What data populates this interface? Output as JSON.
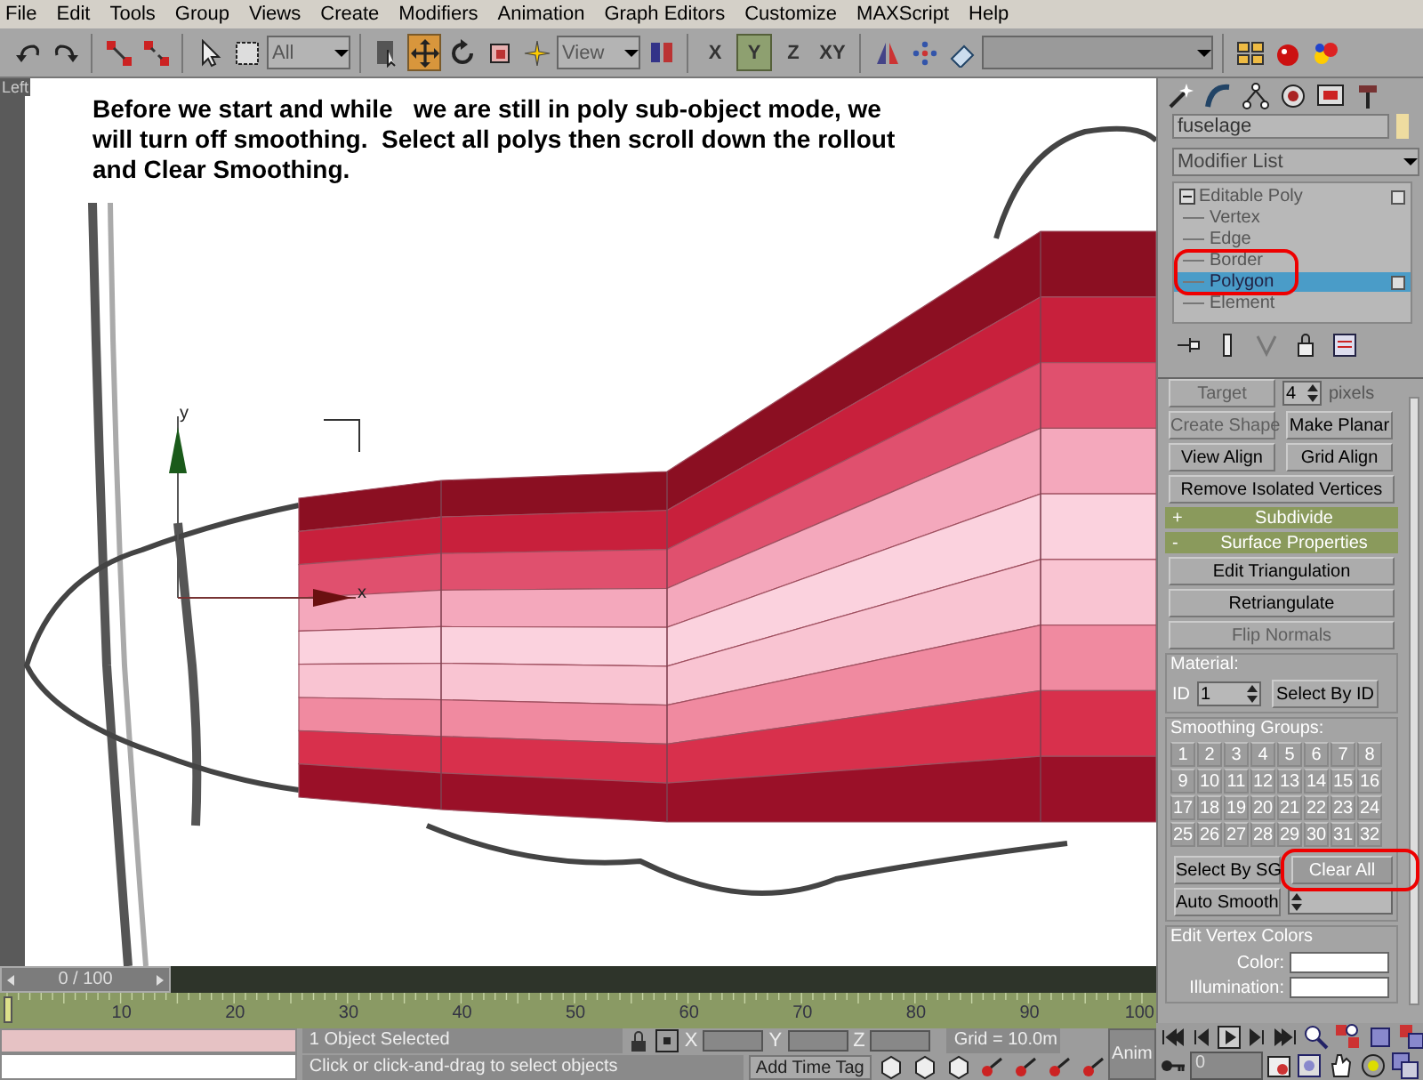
{
  "menu_bar": [
    "File",
    "Edit",
    "Tools",
    "Group",
    "Views",
    "Create",
    "Modifiers",
    "Animation",
    "Graph Editors",
    "Customize",
    "MAXScript",
    "Help"
  ],
  "toolbar": [
    {
      "kind": "tool",
      "selected": false
    },
    {
      "kind": "tool",
      "selected": false
    },
    {
      "kind": "separator"
    },
    {
      "kind": "tool",
      "selected": false
    },
    {
      "kind": "tool",
      "selected": false
    },
    {
      "kind": "separator"
    },
    {
      "kind": "tool",
      "selected": false
    },
    {
      "kind": "tool",
      "selected": false
    },
    {
      "kind": "dropdown",
      "value": "All"
    },
    {
      "kind": "separator"
    },
    {
      "kind": "tool",
      "selected": false
    },
    {
      "kind": "tool",
      "selected": true
    },
    {
      "kind": "tool",
      "selected": false
    },
    {
      "kind": "tool",
      "selected": false
    },
    {
      "kind": "tool",
      "selected": false
    },
    {
      "kind": "dropdown",
      "value": "View"
    },
    {
      "kind": "tool",
      "selected": false
    },
    {
      "kind": "separator"
    },
    {
      "kind": "axis",
      "label": "X",
      "selected": false
    },
    {
      "kind": "axis",
      "label": "Y",
      "selected": true
    },
    {
      "kind": "axis",
      "label": "Z",
      "selected": false
    },
    {
      "kind": "axis",
      "label": "XY",
      "selected": false
    },
    {
      "kind": "separator"
    },
    {
      "kind": "tool",
      "selected": false
    },
    {
      "kind": "tool",
      "selected": false
    },
    {
      "kind": "tool",
      "selected": false
    },
    {
      "kind": "dropdown"
    },
    {
      "kind": "separator"
    },
    {
      "kind": "tool",
      "selected": false
    },
    {
      "kind": "tool",
      "selected": false
    },
    {
      "kind": "tool",
      "selected": false
    }
  ],
  "viewport": {
    "label": "Left",
    "caption": "Before we start and while   we are still in poly sub-object mode, we will turn off smoothing.  Select all polys then scroll down the rollout and Clear Smoothing.",
    "gizmo_axes": [
      "y",
      "x"
    ]
  },
  "command_panel": {
    "object_name": "fuselage",
    "modifier_list": "Modifier List",
    "stack": {
      "label": "Editable Poly",
      "expanded": true,
      "children": [
        {
          "label": "Vertex",
          "selected": false,
          "highlighted": false
        },
        {
          "label": "Edge",
          "selected": false,
          "highlighted": false
        },
        {
          "label": "Border",
          "selected": false,
          "highlighted": false
        },
        {
          "label": "Polygon",
          "selected": true,
          "highlighted": true
        },
        {
          "label": "Element",
          "selected": false,
          "highlighted": false
        }
      ]
    },
    "rollout": [
      {
        "kind": "spinner_row",
        "button": {
          "label": "Target",
          "disabled": true
        },
        "value": "4",
        "unit": "pixels"
      },
      {
        "kind": "button_pair",
        "buttons": [
          {
            "label": "Create Shape",
            "disabled": true
          },
          {
            "label": "Make Planar",
            "disabled": false
          }
        ]
      },
      {
        "kind": "button_pair",
        "buttons": [
          {
            "label": "View Align",
            "disabled": false
          },
          {
            "label": "Grid Align",
            "disabled": false
          }
        ]
      },
      {
        "kind": "button",
        "label": "Remove Isolated Vertices",
        "disabled": false
      },
      {
        "kind": "header",
        "sign": "+",
        "label": "Subdivide"
      },
      {
        "kind": "header",
        "sign": "-",
        "label": "Surface Properties"
      },
      {
        "kind": "button",
        "label": "Edit Triangulation",
        "disabled": false
      },
      {
        "kind": "button",
        "label": "Retriangulate",
        "disabled": false
      },
      {
        "kind": "button",
        "label": "Flip Normals",
        "disabled": true
      },
      {
        "kind": "material",
        "title": "Material:",
        "id_label": "ID",
        "id_value": "1",
        "button": {
          "label": "Select By ID",
          "disabled": false
        }
      },
      {
        "kind": "smoothing",
        "title": "Smoothing Groups:",
        "numbers": [
          "1",
          "2",
          "3",
          "4",
          "5",
          "6",
          "7",
          "8",
          "9",
          "10",
          "11",
          "12",
          "13",
          "14",
          "15",
          "16",
          "17",
          "18",
          "19",
          "20",
          "21",
          "22",
          "23",
          "24",
          "25",
          "26",
          "27",
          "28",
          "29",
          "30",
          "31",
          "32"
        ],
        "select_button": {
          "label": "Select By SG",
          "disabled": false
        },
        "clear_button": {
          "label": "Clear All",
          "disabled": false,
          "highlighted": true
        },
        "auto_button": {
          "label": "Auto Smooth",
          "disabled": false
        }
      },
      {
        "kind": "vertex_colors",
        "title": "Edit Vertex Colors",
        "rows": [
          {
            "label": "Color:"
          },
          {
            "label": "Illumination:"
          }
        ]
      }
    ]
  },
  "time_slider": {
    "label": "0 / 100",
    "level": 0
  },
  "track_bar": {
    "ticks": [
      "10",
      "20",
      "30",
      "40",
      "50",
      "60",
      "70",
      "80",
      "90",
      "100"
    ]
  },
  "status_bar": {
    "selection": "1 Object Selected",
    "prompt": "Click or click-and-drag to select objects",
    "coords": [
      {
        "axis": "X"
      },
      {
        "axis": "Y"
      },
      {
        "axis": "Z"
      }
    ],
    "grid": "Grid = 10.0m",
    "add_time_tag": "Add Time Tag",
    "anim": "Anim"
  },
  "playback": {
    "frame": "0"
  }
}
